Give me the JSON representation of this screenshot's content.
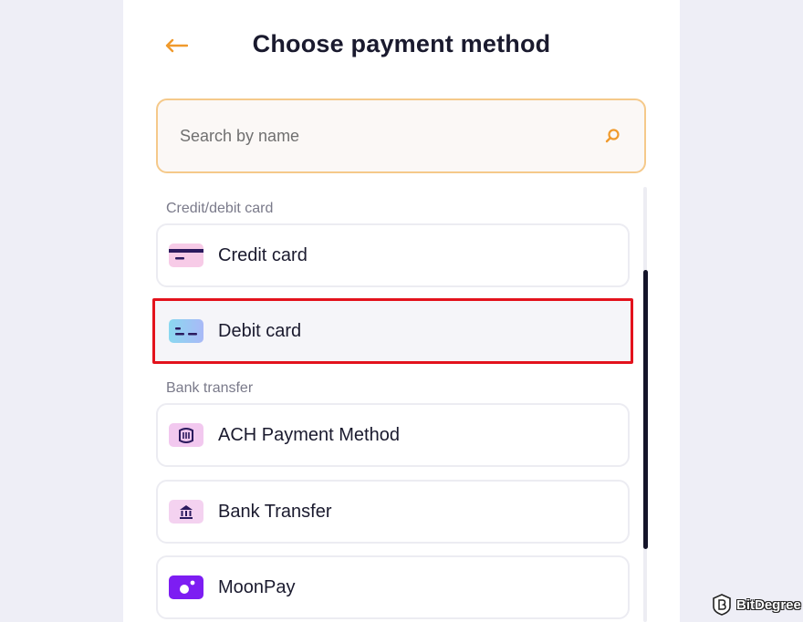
{
  "header": {
    "title": "Choose payment method",
    "back_icon": "arrow-left-icon"
  },
  "search": {
    "placeholder": "Search by name",
    "value": "",
    "icon": "search-icon"
  },
  "sections": [
    {
      "label": "Credit/debit card",
      "items": [
        {
          "label": "Credit card",
          "icon": "credit-card-icon"
        },
        {
          "label": "Debit card",
          "icon": "debit-card-icon",
          "highlighted": true
        }
      ]
    },
    {
      "label": "Bank transfer",
      "items": [
        {
          "label": "ACH Payment Method",
          "icon": "ach-icon"
        },
        {
          "label": "Bank Transfer",
          "icon": "bank-icon"
        },
        {
          "label": "MoonPay",
          "icon": "moonpay-icon"
        }
      ]
    }
  ],
  "watermark": {
    "text": "BitDegree"
  },
  "colors": {
    "accent": "#f09a2c",
    "highlight_border": "#e3121c",
    "search_border": "#f5c98a",
    "text": "#1a1a2e",
    "moonpay": "#7d1df2"
  }
}
